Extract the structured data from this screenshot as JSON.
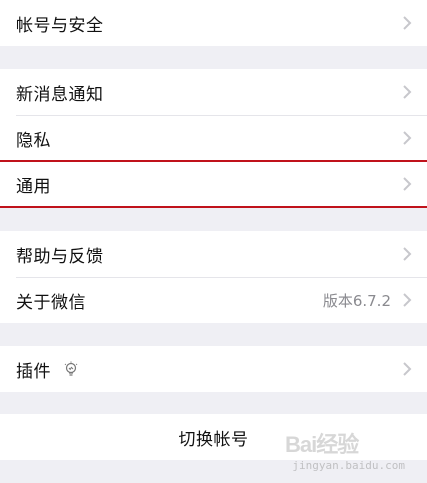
{
  "sections": {
    "account": {
      "label": "帐号与安全"
    },
    "notify": {
      "label": "新消息通知"
    },
    "privacy": {
      "label": "隐私"
    },
    "general": {
      "label": "通用"
    },
    "feedback": {
      "label": "帮助与反馈"
    },
    "about": {
      "label": "关于微信",
      "value": "版本6.7.2"
    },
    "plugins": {
      "label": "插件"
    },
    "switch_account": {
      "label": "切换帐号"
    }
  },
  "watermark": {
    "logo": "Bai经验",
    "url": "jingyan.baidu.com"
  },
  "colors": {
    "highlight": "#c0121b",
    "background": "#efeff4",
    "chevron": "#c7c7cc"
  },
  "icons": {
    "chevron": "chevron-right-icon",
    "plugin": "lightbulb-icon"
  }
}
